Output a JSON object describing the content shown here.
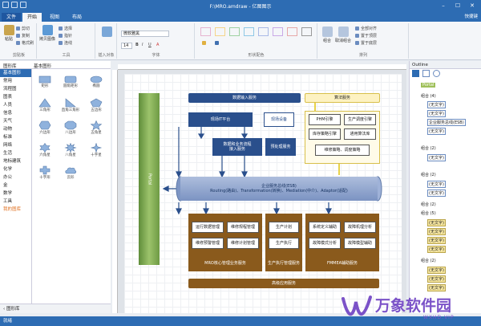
{
  "window": {
    "title": "F:\\MRO.amdraw - 亿图图示"
  },
  "tabs": {
    "file": "文件",
    "items": [
      {
        "label": "开始"
      },
      {
        "label": "视图"
      },
      {
        "label": "布局"
      }
    ]
  },
  "user": "快捷键",
  "ribbon": {
    "clipboard": {
      "label": "剪贴板",
      "paste": "粘贴",
      "cut": "剪切",
      "copy": "复制",
      "painter": "格式刷"
    },
    "tools": {
      "label": "工具",
      "copy_style": "拷贝图像",
      "select": "选择",
      "pointer": "指针",
      "connector": "连线"
    },
    "insert": {
      "label": "插入对象"
    },
    "font": {
      "label": "字体",
      "family": "微软雅黑",
      "size": "14"
    },
    "shape_style": {
      "label": "形状配色"
    },
    "arrange": {
      "label": "排列",
      "group": "组合",
      "ungroup": "取消组合",
      "align": "全部对齐",
      "front": "置于顶层",
      "back": "置于底层"
    }
  },
  "library": {
    "tab1": "图形库",
    "tab2": "基本图形",
    "footer": "图形库",
    "categories": [
      {
        "label": "基本图形"
      },
      {
        "label": "常用"
      },
      {
        "label": "流程图"
      },
      {
        "label": "图表"
      },
      {
        "label": "人员"
      },
      {
        "label": "信息"
      },
      {
        "label": "天气"
      },
      {
        "label": "动物"
      },
      {
        "label": "标准"
      },
      {
        "label": "网络"
      },
      {
        "label": "生活"
      },
      {
        "label": "地标建筑"
      },
      {
        "label": "化学"
      },
      {
        "label": "办公"
      },
      {
        "label": "金"
      },
      {
        "label": "数学"
      },
      {
        "label": "工具"
      },
      {
        "label": "我的图库"
      }
    ],
    "shapes": [
      {
        "label": "矩形"
      },
      {
        "label": "圆角矩形"
      },
      {
        "label": "椭圆"
      },
      {
        "label": "三角形"
      },
      {
        "label": "直角三角形"
      },
      {
        "label": "五边形"
      },
      {
        "label": "六边形"
      },
      {
        "label": "八边形"
      },
      {
        "label": "五角星"
      },
      {
        "label": "六角星"
      },
      {
        "label": "八角星"
      },
      {
        "label": "十字星"
      },
      {
        "label": "十字形"
      },
      {
        "label": "云形"
      }
    ]
  },
  "diagram": {
    "data_input": "数据输入服务",
    "algo": "算法服务",
    "mobile": "现场IT平台",
    "field": "现场设备",
    "phm": "PHM引擎",
    "prod_opt": "生产调度引擎",
    "inventory": "库存策略引擎",
    "general": "通用算法库",
    "maint": "维修策略、调度策略",
    "data_store": "数据和业务流程\n接入服务",
    "preprocess": "预处理服务",
    "portal": "Portal",
    "esb": "企业服务总线(ESB)\nRouting(路由)、Transformation(转换)、Mediation(中介)、Adaptor(适配)",
    "mro_boxes": [
      "运行数据管理",
      "维修规程管理",
      "维修预警管理",
      "维修计划管理"
    ],
    "mro_label": "MRO核心管理业务服务",
    "prod_boxes": [
      "生产计划",
      "生产执行"
    ],
    "prod_label": "生产执行管理服务",
    "fmea_boxes": [
      "系统定义辅助",
      "故障机理分析",
      "故障模式分析",
      "故障模型辅助"
    ],
    "fmea_label": "FMMEA辅助服务",
    "bottom": "高级应用服务"
  },
  "outline": {
    "title": "Outline",
    "items": [
      {
        "label": "组合 (4)"
      },
      {
        "label": "(无文字)"
      },
      {
        "label": "(无文字)"
      },
      {
        "label": "企业服务总线(ESB)"
      },
      {
        "label": "(无文字)"
      },
      {
        "label": "组合 (2)"
      },
      {
        "label": "(无文字)"
      },
      {
        "label": "组合 (2)"
      },
      {
        "label": "(无文字)"
      },
      {
        "label": "(无文字)"
      },
      {
        "label": "组合 (2)"
      },
      {
        "label": "组合 (5)"
      },
      {
        "label": "(无文字)"
      },
      {
        "label": "(无文字)"
      },
      {
        "label": "(无文字)"
      },
      {
        "label": "(无文字)"
      },
      {
        "label": "组合 (2)"
      },
      {
        "label": "(无文字)"
      },
      {
        "label": "(无文字)"
      },
      {
        "label": "(无文字)"
      }
    ]
  },
  "status": "就绪",
  "watermark": {
    "brand": "万象软件园",
    "url": "WXHD.VIP"
  }
}
